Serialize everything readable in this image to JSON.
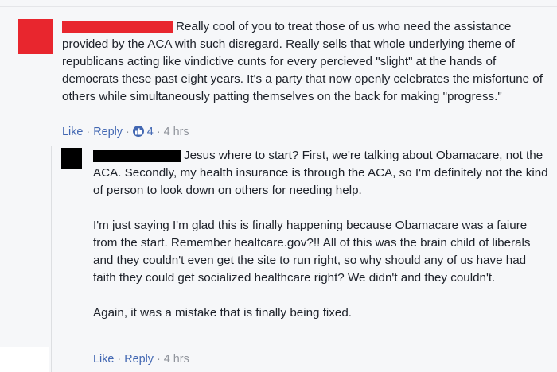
{
  "comment": {
    "text": "Really cool of you to treat those of us who need the assistance provided by the ACA with such disregard. Really sells that whole underlying theme of republicans acting like vindictive cunts for every percieved \"slight\" at the hands of democrats these past eight years. It's a party that now openly celebrates the misfortune of others while simultaneously patting themselves on the back for making \"progress.\"",
    "like_label": "Like",
    "reply_label": "Reply",
    "reaction_count": "4",
    "timestamp": "4 hrs",
    "colors": {
      "avatar": "#e8262e",
      "redaction": "#e8262e",
      "link": "#4267b2"
    }
  },
  "reply": {
    "paragraphs": [
      "Jesus where to start? First, we're talking about Obamacare, not the ACA. Secondly, my health insurance is through the ACA, so I'm definitely not the kind of person to look down on others for needing help.",
      "I'm just saying I'm glad this is finally happening because Obamacare was a faiure from the start. Remember healtcare.gov?!! All of this was the brain child of liberals and they couldn't even get the site to run right, so why should any of us have had faith they could get socialized healthcare right? We didn't and they couldn't.",
      "Again, it was a mistake that is finally being fixed."
    ],
    "like_label": "Like",
    "reply_label": "Reply",
    "timestamp": "4 hrs",
    "colors": {
      "avatar": "#000000",
      "redaction": "#000000"
    }
  },
  "separator": "·",
  "icons": {
    "reaction": "thumbs-up-icon"
  }
}
